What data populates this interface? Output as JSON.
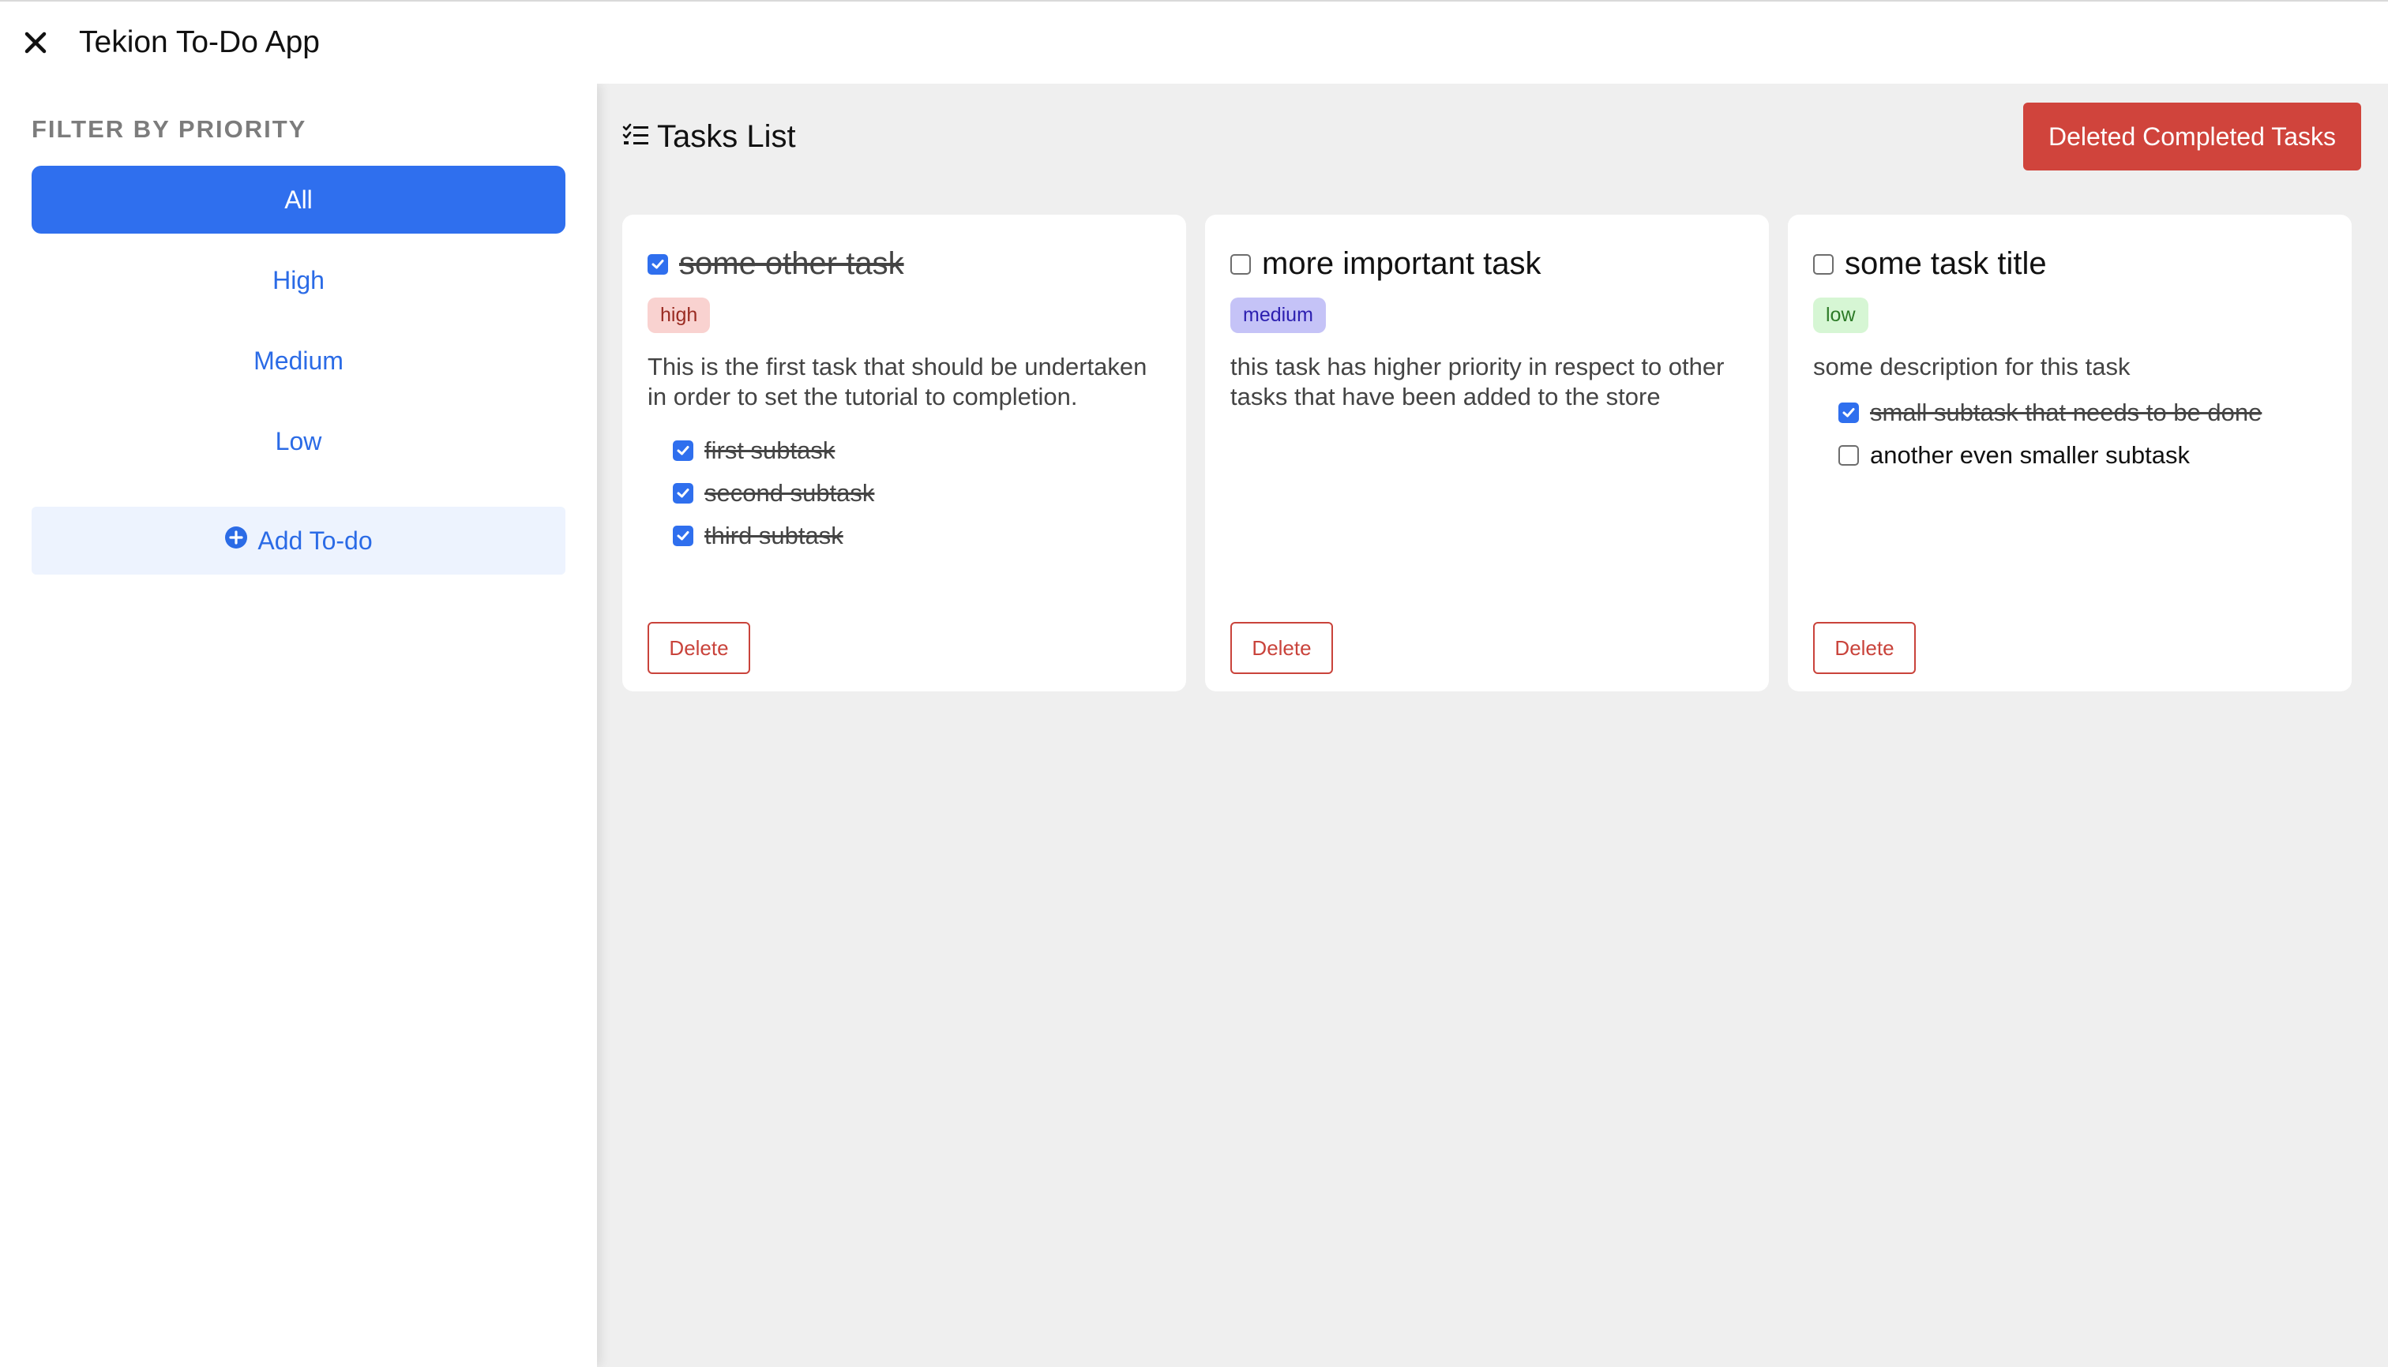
{
  "app": {
    "title": "Tekion To-Do App",
    "close_icon": "close-icon"
  },
  "sidebar": {
    "heading": "FILTER BY PRIORITY",
    "filters": [
      {
        "label": "All",
        "active": true
      },
      {
        "label": "High",
        "active": false
      },
      {
        "label": "Medium",
        "active": false
      },
      {
        "label": "Low",
        "active": false
      }
    ],
    "add_todo": {
      "label": "Add To-do",
      "icon": "plus-circle-icon"
    }
  },
  "main": {
    "title": "Tasks List",
    "title_icon": "checklist-icon",
    "delete_completed_label": "Deleted Completed Tasks"
  },
  "tasks": [
    {
      "title": "some other task",
      "completed": true,
      "priority": "high",
      "description": "This is the first task that should be undertaken in order to set the tutorial to completion.",
      "subtasks": [
        {
          "label": "first subtask",
          "done": true
        },
        {
          "label": "second subtask",
          "done": true
        },
        {
          "label": "third subtask",
          "done": true
        }
      ],
      "delete_label": "Delete"
    },
    {
      "title": "more important task",
      "completed": false,
      "priority": "medium",
      "description": "this task has higher priority in respect to other tasks that have been added to the store",
      "subtasks": [],
      "delete_label": "Delete"
    },
    {
      "title": "some task title",
      "completed": false,
      "priority": "low",
      "description": "some description for this task",
      "subtasks": [
        {
          "label": "small subtask that needs to be done",
          "done": true
        },
        {
          "label": "another even smaller subtask",
          "done": false
        }
      ],
      "delete_label": "Delete"
    }
  ],
  "colors": {
    "accent": "#2f6fee",
    "danger": "#d0443c",
    "high_bg": "#f9d2d0",
    "medium_bg": "#c5c3f7",
    "low_bg": "#d6f6d4"
  }
}
